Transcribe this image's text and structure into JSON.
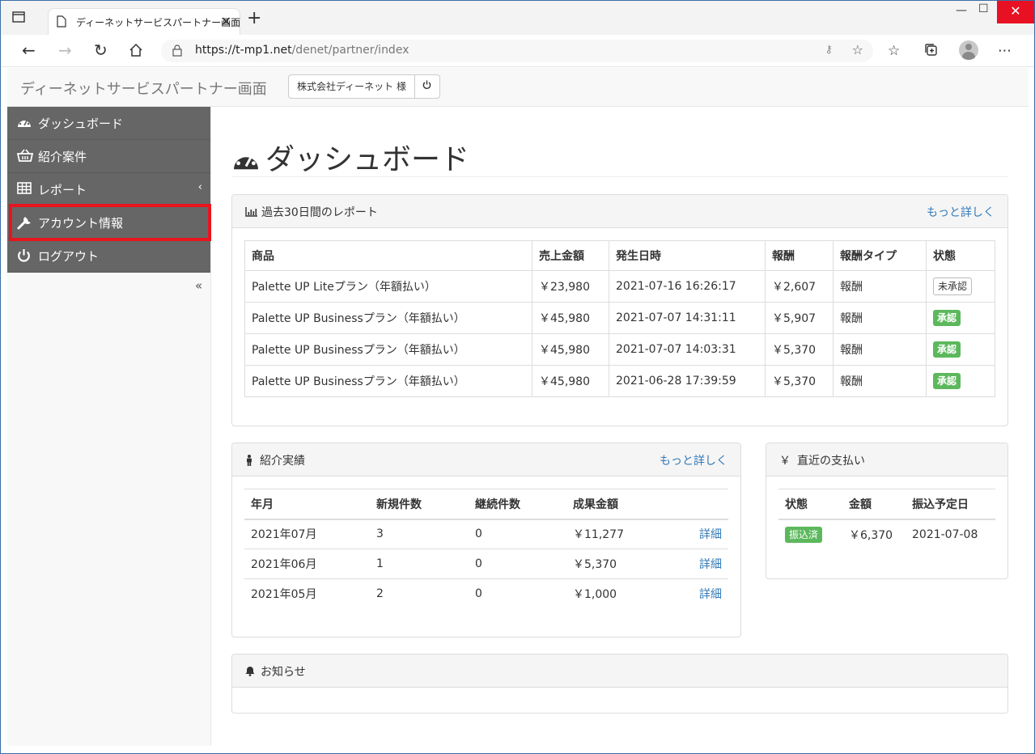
{
  "browser": {
    "tab_title": "ディーネットサービスパートナー画面",
    "url_host": "https://t-mp1.net",
    "url_path": "/denet/partner/index",
    "min": "—",
    "max": "☐",
    "close": "✕"
  },
  "header": {
    "brand": "ディーネットサービスパートナー画面",
    "user": "株式会社ディーネット 様"
  },
  "sidebar": {
    "items": [
      {
        "label": "ダッシュボード",
        "icon": "dashboard-icon"
      },
      {
        "label": "紹介案件",
        "icon": "basket-icon"
      },
      {
        "label": "レポート",
        "icon": "table-icon",
        "caret": "‹"
      },
      {
        "label": "アカウント情報",
        "icon": "wrench-icon"
      },
      {
        "label": "ログアウト",
        "icon": "power-icon"
      }
    ],
    "collapse": "«"
  },
  "page": {
    "title": "ダッシュボード"
  },
  "report_panel": {
    "title": "過去30日間のレポート",
    "more": "もっと詳しく",
    "headers": [
      "商品",
      "売上金額",
      "発生日時",
      "報酬",
      "報酬タイプ",
      "状態"
    ],
    "rows": [
      {
        "product": "Palette UP Liteプラン（年額払い）",
        "sales": "￥23,980",
        "date": "2021-07-16 16:26:17",
        "reward": "￥2,607",
        "type": "報酬",
        "status": "未承認",
        "status_kind": "pending"
      },
      {
        "product": "Palette UP Businessプラン（年額払い）",
        "sales": "￥45,980",
        "date": "2021-07-07 14:31:11",
        "reward": "￥5,907",
        "type": "報酬",
        "status": "承認",
        "status_kind": "ok"
      },
      {
        "product": "Palette UP Businessプラン（年額払い）",
        "sales": "￥45,980",
        "date": "2021-07-07 14:03:31",
        "reward": "￥5,370",
        "type": "報酬",
        "status": "承認",
        "status_kind": "ok"
      },
      {
        "product": "Palette UP Businessプラン（年額払い）",
        "sales": "￥45,980",
        "date": "2021-06-28 17:39:59",
        "reward": "￥5,370",
        "type": "報酬",
        "status": "承認",
        "status_kind": "ok"
      }
    ]
  },
  "referral_panel": {
    "title": "紹介実績",
    "more": "もっと詳しく",
    "headers": [
      "年月",
      "新規件数",
      "継続件数",
      "成果金額"
    ],
    "rows": [
      {
        "month": "2021年07月",
        "new": "3",
        "cont": "0",
        "amount": "￥11,277",
        "link": "詳細"
      },
      {
        "month": "2021年06月",
        "new": "1",
        "cont": "0",
        "amount": "￥5,370",
        "link": "詳細"
      },
      {
        "month": "2021年05月",
        "new": "2",
        "cont": "0",
        "amount": "￥1,000",
        "link": "詳細"
      }
    ]
  },
  "payment_panel": {
    "title": "直近の支払い",
    "icon_text": "￥",
    "headers": [
      "状態",
      "金額",
      "振込予定日"
    ],
    "rows": [
      {
        "status": "振込済",
        "amount": "￥6,370",
        "date": "2021-07-08"
      }
    ]
  },
  "notice_panel": {
    "title": "お知らせ"
  },
  "colors": {
    "sidebar_bg": "#666666",
    "highlight": "#e8141e",
    "success": "#5cb85c",
    "link": "#337ab7"
  }
}
